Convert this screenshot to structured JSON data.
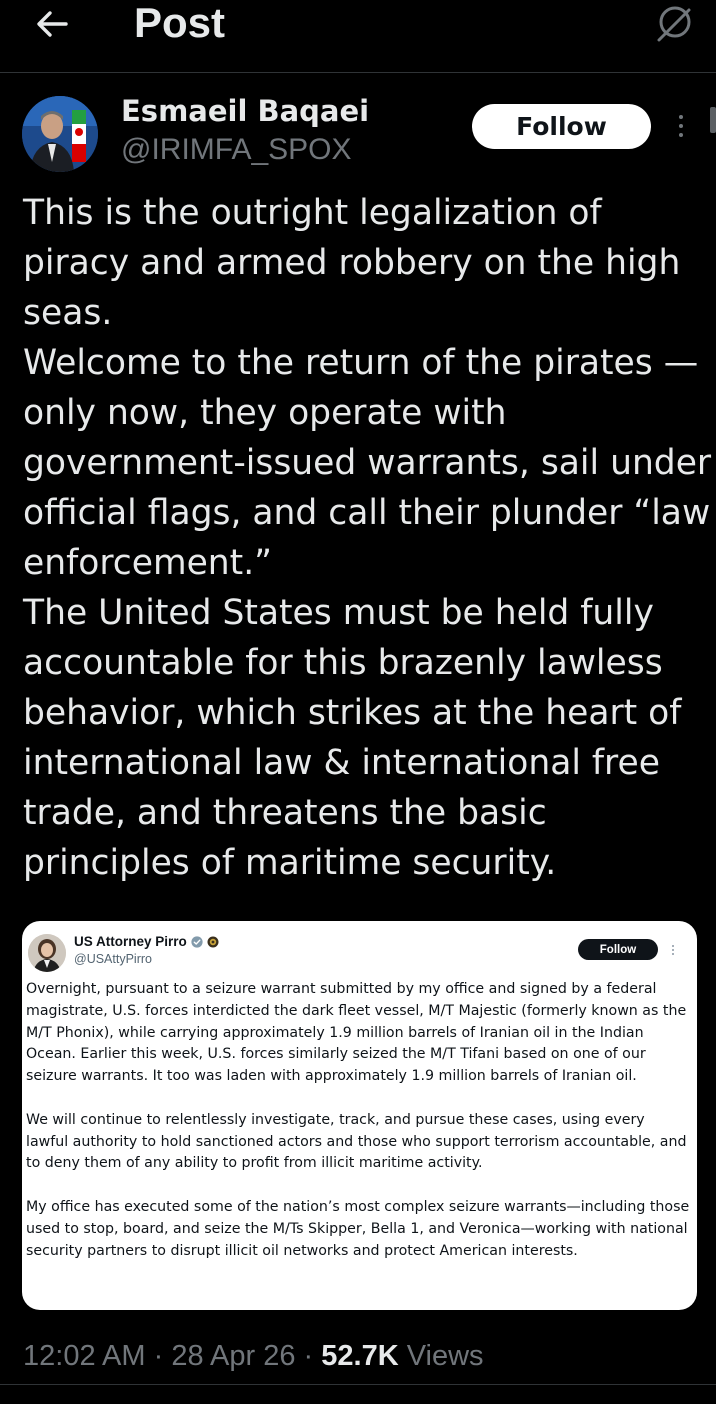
{
  "header": {
    "title": "Post",
    "back_icon": "arrow-left-icon",
    "grok_icon": "slash-circle-icon"
  },
  "author": {
    "name": "Esmaeil Baqaei",
    "handle": "@IRIMFA_SPOX",
    "follow_label": "Follow"
  },
  "post": {
    "paragraphs": [
      "This is the outright legalization of piracy and armed robbery on the high seas.",
      "Welcome to the return of the pirates — only now, they operate with government-issued warrants, sail under official flags, and call their plunder “law enforcement.”",
      "The United States must be held fully accountable for this brazenly lawless behavior, which strikes at the heart of international law & international free trade, and threatens the basic principles of maritime security."
    ]
  },
  "embedded": {
    "name": "US Attorney Pirro",
    "handle": "@USAttyPirro",
    "follow_label": "Follow",
    "verified_color": "#829aab",
    "paragraphs": [
      "Overnight, pursuant to a seizure warrant submitted by my office and signed by a federal magistrate, U.S. forces interdicted the dark fleet vessel, M/T Majestic (formerly known as the M/T Phonix), while carrying approximately 1.9 million barrels of Iranian oil in the Indian Ocean. Earlier this week, U.S. forces similarly seized the M/T Tifani based on one of our seizure warrants. It too was laden with approximately 1.9 million barrels of Iranian oil.",
      "We will continue to relentlessly investigate, track, and pursue these cases, using every lawful authority to hold sanctioned actors and those who support terrorism accountable, and to deny them of any ability to profit from illicit maritime activity.",
      "My office has executed some of the nation’s most complex seizure warrants—including those used to stop, board, and seize the M/Ts Skipper, Bella 1, and Veronica—working with national security partners to disrupt illicit oil networks and protect American interests."
    ]
  },
  "meta": {
    "time": "12:02 AM",
    "separator": " · ",
    "date": "28 Apr 26",
    "views_count": "52.7K",
    "views_label": " Views"
  },
  "colors": {
    "background": "#000000",
    "text": "#e7e9ea",
    "secondary": "#71767b",
    "divider": "#2f3336"
  }
}
